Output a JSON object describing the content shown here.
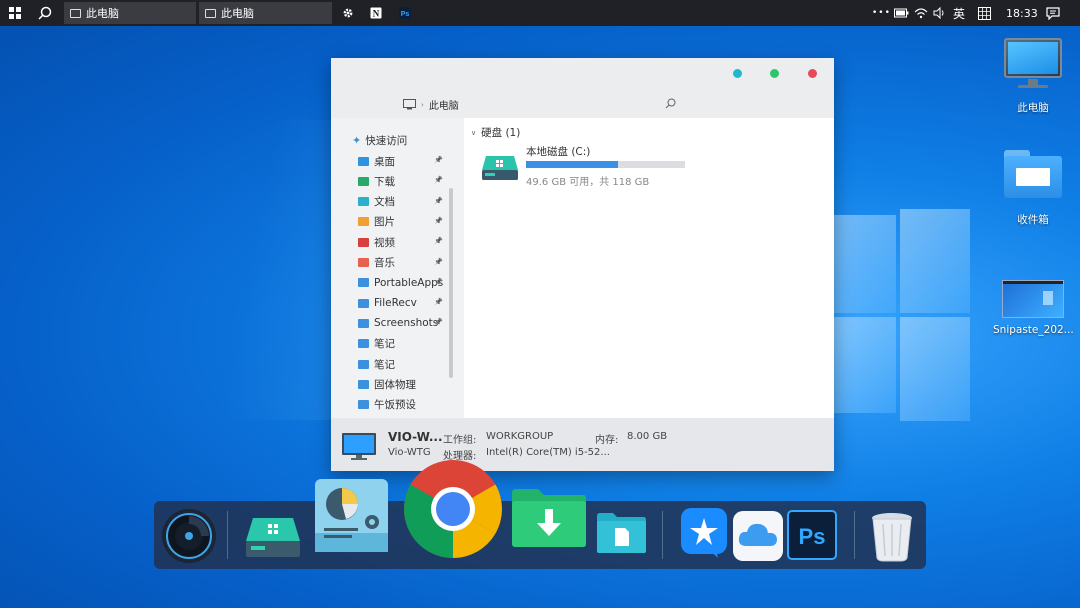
{
  "taskbar": {
    "tabs": [
      {
        "label": "此电脑"
      },
      {
        "label": "此电脑"
      }
    ],
    "tray": {
      "more": "•••",
      "ime": "英",
      "time": "18:33"
    }
  },
  "explorer": {
    "breadcrumb": "此电脑",
    "search_placeholder": "",
    "quick_access": "快速访问",
    "nav_items": [
      {
        "label": "桌面",
        "pinned": true,
        "color": "#2f93e0"
      },
      {
        "label": "下载",
        "pinned": true,
        "color": "#2aa86a"
      },
      {
        "label": "文档",
        "pinned": true,
        "color": "#2ab0c8"
      },
      {
        "label": "图片",
        "pinned": true,
        "color": "#f0a030"
      },
      {
        "label": "视频",
        "pinned": true,
        "color": "#d84040"
      },
      {
        "label": "音乐",
        "pinned": true,
        "color": "#e86050"
      },
      {
        "label": "PortableApps",
        "pinned": true,
        "color": "#3d8fe0"
      },
      {
        "label": "FileRecv",
        "pinned": true,
        "color": "#3d8fe0"
      },
      {
        "label": "Screenshots",
        "pinned": true,
        "color": "#3d8fe0"
      },
      {
        "label": "笔记",
        "pinned": false,
        "color": "#3d8fe0"
      },
      {
        "label": "笔记",
        "pinned": false,
        "color": "#3d8fe0"
      },
      {
        "label": "固体物理",
        "pinned": false,
        "color": "#3d8fe0"
      },
      {
        "label": "午饭预设",
        "pinned": false,
        "color": "#3d8fe0"
      }
    ],
    "section_title": "硬盘 (1)",
    "drive": {
      "name": "本地磁盘 (C:)",
      "detail": "49.6 GB 可用，共 118 GB",
      "used_fraction": 0.58
    },
    "status": {
      "computer_name": "VIO-W...",
      "computer_sub": "Vio-WTG",
      "workgroup_label": "工作组:",
      "workgroup_value": "WORKGROUP",
      "memory_label": "内存:",
      "memory_value": "8.00 GB",
      "cpu_label": "处理器:",
      "cpu_value": "Intel(R) Core(TM) i5-52..."
    },
    "window_controls": {
      "colors": [
        "#22b8c8",
        "#2fc66a",
        "#e8485a"
      ]
    }
  },
  "desktop_icons": [
    {
      "label": "此电脑"
    },
    {
      "label": "收件箱"
    },
    {
      "label": "Snipaste_202..."
    }
  ],
  "dock": {
    "ps_label": "Ps"
  },
  "colors": {
    "accent": "#2f93e0",
    "drive_bar": "#3a8fe8"
  }
}
